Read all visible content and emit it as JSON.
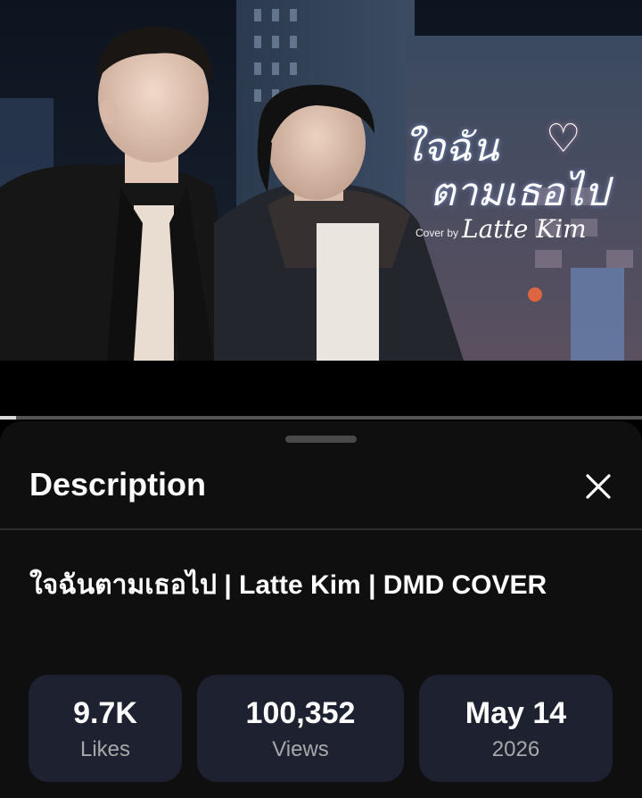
{
  "video": {
    "overlay_title_line1": "ใจฉัน",
    "overlay_title_line2": "ตามเธอไป",
    "overlay_cover_label": "Cover by",
    "overlay_artist": "Latte Kim",
    "progress_fraction": 0.025
  },
  "sheet": {
    "title": "Description",
    "video_title": "ใจฉันตามเธอไป | Latte Kim | DMD COVER",
    "stats": {
      "likes_value": "9.7K",
      "likes_label": "Likes",
      "views_value": "100,352",
      "views_label": "Views",
      "date_value": "May 14",
      "date_year": "2026"
    }
  },
  "icons": {
    "close": "close-icon",
    "heart": "heart-icon"
  },
  "colors": {
    "sheet_background": "#0f0f0f",
    "stat_card": "#1e2230",
    "secondary_text": "#a8a8a8"
  }
}
